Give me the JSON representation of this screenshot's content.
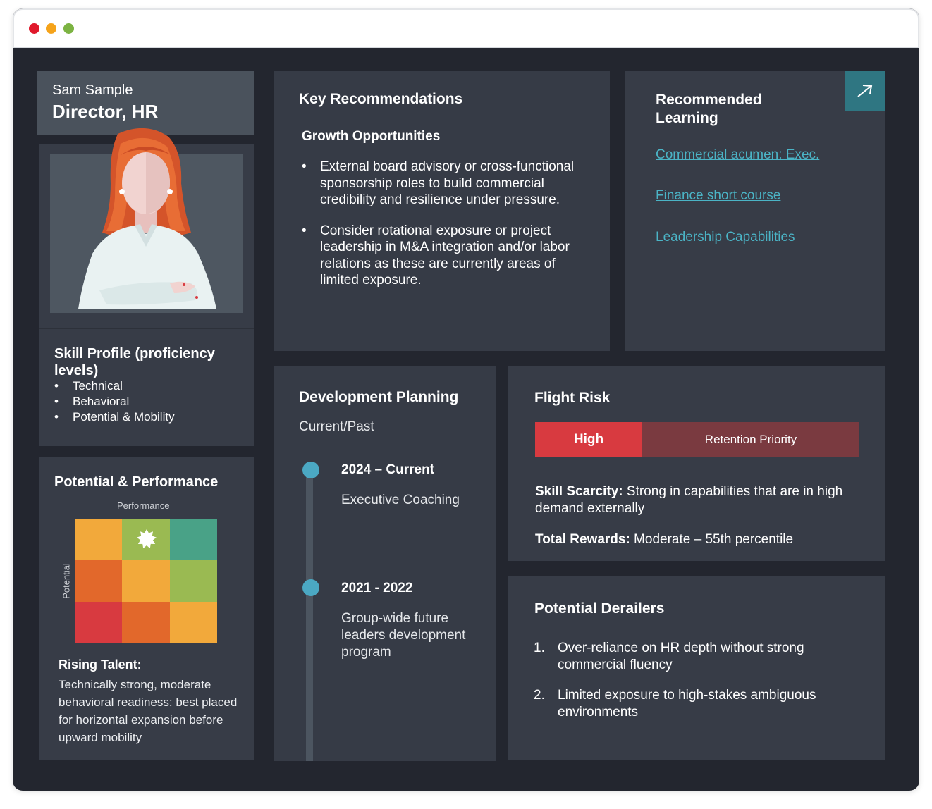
{
  "profile": {
    "name": "Sam Sample",
    "role": "Director, HR"
  },
  "skill_profile": {
    "title": "Skill Profile (proficiency levels)",
    "items": [
      "Technical",
      "Behavioral",
      "Potential & Mobility"
    ]
  },
  "potential_performance": {
    "title": "Potential & Performance",
    "x_label": "Performance",
    "y_label": "Potential",
    "grid_colors": [
      [
        "#f2a93b",
        "#9aba52",
        "#49a287"
      ],
      [
        "#e2682b",
        "#f2a93b",
        "#9aba52"
      ],
      [
        "#d83a40",
        "#e2682b",
        "#f2a93b"
      ]
    ],
    "marker_icon": "star-burst-icon",
    "rising_title": "Rising Talent:",
    "rising_text": "Technically strong, moderate behavioral readiness: best placed for horizontal expansion before upward mobility"
  },
  "key_recommendations": {
    "title": "Key Recommendations",
    "subtitle": "Growth Opportunities",
    "items": [
      "External board advisory or cross-functional sponsorship roles to build commercial credibility and resilience under pressure.",
      "Consider rotational exposure or project leadership in M&A integration and/or labor relations as these are currently areas of limited exposure."
    ]
  },
  "recommended_learning": {
    "title": "Recommended Learning",
    "arrow_icon": "external-link-arrow-icon",
    "links": [
      "Commercial acumen: Exec.",
      "Finance short course",
      "Leadership Capabilities"
    ]
  },
  "development_planning": {
    "title": "Development Planning",
    "subtitle": "Current/Past",
    "entries": [
      {
        "period": "2024 – Current",
        "description": "Executive Coaching"
      },
      {
        "period": "2021 - 2022",
        "description": "Group-wide future leaders development program"
      }
    ]
  },
  "flight_risk": {
    "title": "Flight Risk",
    "level": "High",
    "priority": "Retention Priority",
    "skill_scarcity_label": "Skill Scarcity:",
    "skill_scarcity_text": " Strong in capabilities that are in high demand externally",
    "total_rewards_label": "Total Rewards:",
    "total_rewards_text": " Moderate – 55th percentile",
    "colors": {
      "high": "#d83a40",
      "priority": "#7a3a40"
    }
  },
  "potential_derailers": {
    "title": "Potential Derailers",
    "items": [
      {
        "num": "1.",
        "text": "Over-reliance on HR depth without strong commercial fluency"
      },
      {
        "num": "2.",
        "text": "Limited exposure to high-stakes ambiguous environments"
      }
    ]
  }
}
